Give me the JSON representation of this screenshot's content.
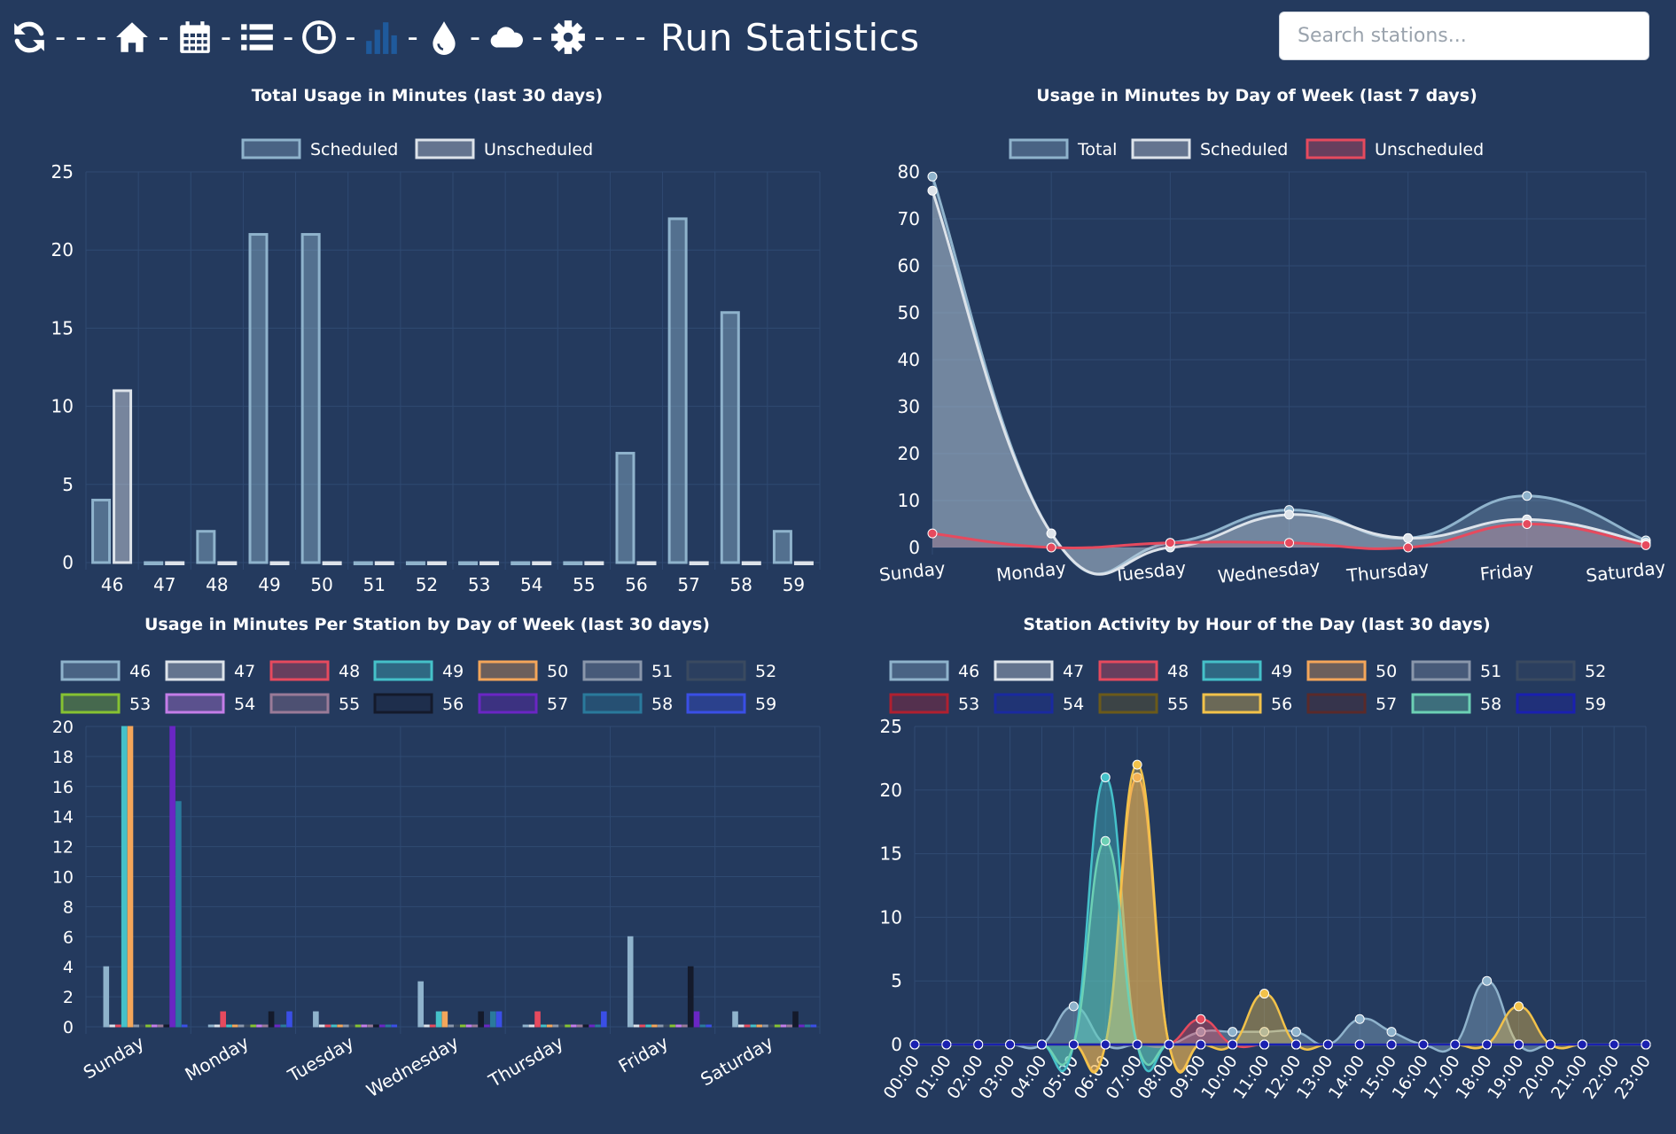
{
  "header": {
    "title": "Run Statistics",
    "separators": [
      "- - -",
      "-",
      "-",
      "-",
      "-",
      "-",
      "-",
      "-",
      "- - -"
    ],
    "icons": [
      "refresh-icon",
      "home-icon",
      "calendar-icon",
      "list-icon",
      "clock-icon",
      "bar-chart-icon",
      "water-drop-icon",
      "cloud-icon",
      "gear-icon"
    ],
    "search_placeholder": "Search stations..."
  },
  "colors": {
    "background": "#243a5e",
    "grid": "#2f4a72",
    "axis_text": "#ffffff",
    "stations": {
      "46": "#8fb3cc",
      "47": "#dde3ea",
      "48": "#e64a5e",
      "49": "#45c1c9",
      "50": "#f4a65a",
      "51": "#8a97ab",
      "52": "#3a4a60",
      "53": "#86c232",
      "54": "#c47de8",
      "55": "#9a7b98",
      "56": "#141a2b",
      "57": "#6a26c4",
      "58": "#2a7a9c",
      "59": "#3a4fe6"
    },
    "stations_hourly": {
      "46": "#8fb3cc",
      "47": "#dde3ea",
      "48": "#e64a5e",
      "49": "#45c1c9",
      "50": "#f4a65a",
      "51": "#8a97ab",
      "52": "#3a4a60",
      "53": "#b02030",
      "54": "#1a2aa0",
      "55": "#6b5a1a",
      "56": "#f2c24a",
      "57": "#5a2a2a",
      "58": "#6cd0b4",
      "59": "#1a20b0"
    }
  },
  "chart_data": [
    {
      "type": "bar",
      "title": "Total Usage in Minutes (last 30 days)",
      "categories": [
        "46",
        "47",
        "48",
        "49",
        "50",
        "51",
        "52",
        "53",
        "54",
        "55",
        "56",
        "57",
        "58",
        "59"
      ],
      "series": [
        {
          "name": "Scheduled",
          "color": "#8fb3cc",
          "values": [
            4,
            0,
            2,
            21,
            21,
            0,
            0,
            0,
            0,
            0,
            7,
            22,
            16,
            2
          ]
        },
        {
          "name": "Unscheduled",
          "color": "#dde3ea",
          "values": [
            11,
            0,
            0,
            0,
            0,
            0,
            0,
            0,
            0,
            0,
            0,
            0,
            0,
            0
          ]
        }
      ],
      "ylim": [
        0,
        25
      ],
      "yticks": [
        0,
        5,
        10,
        15,
        20,
        25
      ],
      "legend": "top",
      "grid": true
    },
    {
      "type": "area",
      "title": "Usage in Minutes by Day of Week (last 7 days)",
      "categories": [
        "Sunday",
        "Monday",
        "Tuesday",
        "Wednesday",
        "Thursday",
        "Friday",
        "Saturday"
      ],
      "series": [
        {
          "name": "Total",
          "color": "#8fb3cc",
          "values": [
            79,
            3,
            1,
            8,
            2,
            11,
            1.5
          ]
        },
        {
          "name": "Scheduled",
          "color": "#dde3ea",
          "values": [
            76,
            3,
            0,
            7,
            2,
            6,
            1
          ]
        },
        {
          "name": "Unscheduled",
          "color": "#e64a5e",
          "values": [
            3,
            0,
            1,
            1,
            0,
            5,
            0.5
          ]
        }
      ],
      "ylim": [
        0,
        80
      ],
      "yticks": [
        0,
        10,
        20,
        30,
        40,
        50,
        60,
        70,
        80
      ],
      "legend": "top",
      "grid": true
    },
    {
      "type": "bar",
      "title": "Usage in Minutes Per Station by Day of Week (last 30 days)",
      "categories": [
        "Sunday",
        "Monday",
        "Tuesday",
        "Wednesday",
        "Thursday",
        "Friday",
        "Saturday"
      ],
      "series": [
        {
          "name": "46",
          "values": [
            4,
            0,
            1,
            3,
            0,
            6,
            1
          ]
        },
        {
          "name": "47",
          "values": [
            0,
            0,
            0,
            0,
            0,
            0,
            0
          ]
        },
        {
          "name": "48",
          "values": [
            0,
            1,
            0,
            0,
            1,
            0,
            0
          ]
        },
        {
          "name": "49",
          "values": [
            21,
            0,
            0,
            1,
            0,
            0,
            0
          ]
        },
        {
          "name": "50",
          "values": [
            21,
            0,
            0,
            1,
            0,
            0,
            0
          ]
        },
        {
          "name": "51",
          "values": [
            0,
            0,
            0,
            0,
            0,
            0,
            0
          ]
        },
        {
          "name": "52",
          "values": [
            0,
            0,
            0,
            0,
            0,
            0,
            0
          ]
        },
        {
          "name": "53",
          "values": [
            0,
            0,
            0,
            0,
            0,
            0,
            0
          ]
        },
        {
          "name": "54",
          "values": [
            0,
            0,
            0,
            0,
            0,
            0,
            0
          ]
        },
        {
          "name": "55",
          "values": [
            0,
            0,
            0,
            0,
            0,
            0,
            0
          ]
        },
        {
          "name": "56",
          "values": [
            0,
            1,
            0,
            1,
            0,
            4,
            1
          ]
        },
        {
          "name": "57",
          "values": [
            22,
            0,
            0,
            0,
            0,
            1,
            0
          ]
        },
        {
          "name": "58",
          "values": [
            15,
            0,
            0,
            1,
            0,
            0,
            0
          ]
        },
        {
          "name": "59",
          "values": [
            0,
            1,
            0,
            1,
            1,
            0,
            0
          ]
        }
      ],
      "ylim": [
        0,
        20
      ],
      "yticks": [
        0,
        2,
        4,
        6,
        8,
        10,
        12,
        14,
        16,
        18,
        20
      ],
      "legend": "top",
      "grid": true
    },
    {
      "type": "area",
      "title": "Station Activity by Hour of the Day (last 30 days)",
      "x": [
        "00:00",
        "01:00",
        "02:00",
        "03:00",
        "04:00",
        "05:00",
        "06:00",
        "07:00",
        "08:00",
        "09:00",
        "10:00",
        "11:00",
        "12:00",
        "13:00",
        "14:00",
        "15:00",
        "16:00",
        "17:00",
        "18:00",
        "19:00",
        "20:00",
        "21:00",
        "22:00",
        "23:00"
      ],
      "series": [
        {
          "name": "46",
          "values": [
            0,
            0,
            0,
            0,
            0,
            3,
            0,
            0,
            0,
            1,
            1,
            1,
            1,
            0,
            2,
            1,
            0,
            0,
            5,
            0,
            0,
            0,
            0,
            0
          ]
        },
        {
          "name": "47",
          "values": [
            0,
            0,
            0,
            0,
            0,
            0,
            0,
            0,
            0,
            0,
            0,
            0,
            0,
            0,
            0,
            0,
            0,
            0,
            0,
            0,
            0,
            0,
            0,
            0
          ]
        },
        {
          "name": "48",
          "values": [
            0,
            0,
            0,
            0,
            0,
            0,
            0,
            0,
            0,
            2,
            0,
            0,
            0,
            0,
            0,
            0,
            0,
            0,
            0,
            0,
            0,
            0,
            0,
            0
          ]
        },
        {
          "name": "49",
          "values": [
            0,
            0,
            0,
            0,
            0,
            0,
            21,
            0,
            0,
            0,
            0,
            0,
            0,
            0,
            0,
            0,
            0,
            0,
            0,
            0,
            0,
            0,
            0,
            0
          ]
        },
        {
          "name": "50",
          "values": [
            0,
            0,
            0,
            0,
            0,
            0,
            0,
            21,
            0,
            0,
            0,
            0,
            0,
            0,
            0,
            0,
            0,
            0,
            0,
            0,
            0,
            0,
            0,
            0
          ]
        },
        {
          "name": "51",
          "values": [
            0,
            0,
            0,
            0,
            0,
            0,
            0,
            0,
            0,
            0,
            0,
            0,
            0,
            0,
            0,
            0,
            0,
            0,
            0,
            0,
            0,
            0,
            0,
            0
          ]
        },
        {
          "name": "52",
          "values": [
            0,
            0,
            0,
            0,
            0,
            0,
            0,
            0,
            0,
            0,
            0,
            0,
            0,
            0,
            0,
            0,
            0,
            0,
            0,
            0,
            0,
            0,
            0,
            0
          ]
        },
        {
          "name": "53",
          "values": [
            0,
            0,
            0,
            0,
            0,
            0,
            0,
            0,
            0,
            0,
            0,
            0,
            0,
            0,
            0,
            0,
            0,
            0,
            0,
            0,
            0,
            0,
            0,
            0
          ]
        },
        {
          "name": "54",
          "values": [
            0,
            0,
            0,
            0,
            0,
            0,
            0,
            0,
            0,
            0,
            0,
            0,
            0,
            0,
            0,
            0,
            0,
            0,
            0,
            0,
            0,
            0,
            0,
            0
          ]
        },
        {
          "name": "55",
          "values": [
            0,
            0,
            0,
            0,
            0,
            0,
            0,
            0,
            0,
            0,
            0,
            0,
            0,
            0,
            0,
            0,
            0,
            0,
            0,
            0,
            0,
            0,
            0,
            0
          ]
        },
        {
          "name": "56",
          "values": [
            0,
            0,
            0,
            0,
            0,
            0,
            0,
            22,
            0,
            0,
            0,
            4,
            0,
            0,
            0,
            0,
            0,
            0,
            0,
            3,
            0,
            0,
            0,
            0
          ]
        },
        {
          "name": "57",
          "values": [
            0,
            0,
            0,
            0,
            0,
            0,
            0,
            0,
            0,
            0,
            0,
            0,
            0,
            0,
            0,
            0,
            0,
            0,
            0,
            0,
            0,
            0,
            0,
            0
          ]
        },
        {
          "name": "58",
          "values": [
            0,
            0,
            0,
            0,
            0,
            0,
            16,
            0,
            0,
            0,
            0,
            0,
            0,
            0,
            0,
            0,
            0,
            0,
            0,
            0,
            0,
            0,
            0,
            0
          ]
        },
        {
          "name": "59",
          "values": [
            0,
            0,
            0,
            0,
            0,
            0,
            0,
            0,
            0,
            0,
            0,
            0,
            0,
            0,
            0,
            0,
            0,
            0,
            0,
            0,
            0,
            0,
            0,
            0
          ]
        }
      ],
      "ylim": [
        0,
        25
      ],
      "yticks": [
        0,
        5,
        10,
        15,
        20,
        25
      ],
      "legend": "top",
      "grid": true
    }
  ]
}
